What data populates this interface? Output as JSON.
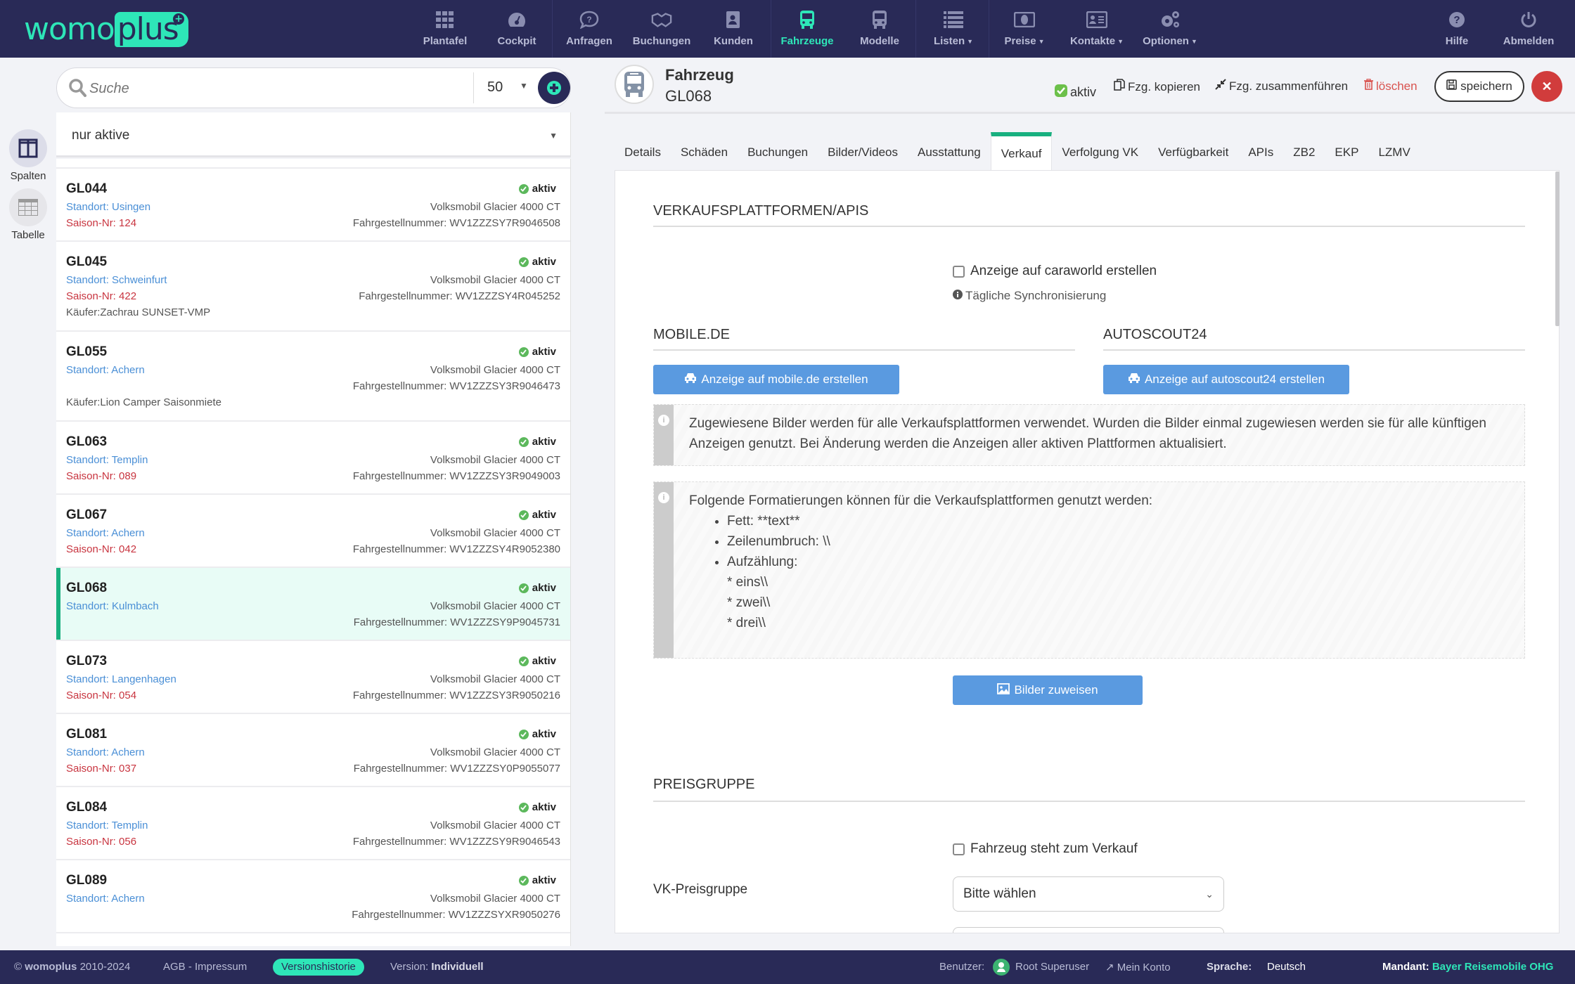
{
  "nav": {
    "brand_a": "womo",
    "brand_b": "plus",
    "items": [
      {
        "label": "Plantafel",
        "icon": "grid-icon"
      },
      {
        "label": "Cockpit",
        "icon": "dashboard-icon"
      },
      {
        "label": "Anfragen",
        "icon": "question-bubble-icon"
      },
      {
        "label": "Buchungen",
        "icon": "handshake-icon"
      },
      {
        "label": "Kunden",
        "icon": "address-book-icon"
      },
      {
        "label": "Fahrzeuge",
        "icon": "bus-icon",
        "active": true
      },
      {
        "label": "Modelle",
        "icon": "bus-icon"
      },
      {
        "label": "Listen",
        "icon": "list-icon",
        "dropdown": true
      },
      {
        "label": "Preise",
        "icon": "money-icon",
        "dropdown": true
      },
      {
        "label": "Kontakte",
        "icon": "contact-card-icon",
        "dropdown": true
      },
      {
        "label": "Optionen",
        "icon": "gears-icon",
        "dropdown": true
      }
    ],
    "help": "Hilfe",
    "logout": "Abmelden"
  },
  "rail": {
    "columns_label": "Spalten",
    "table_label": "Tabelle"
  },
  "search": {
    "placeholder": "Suche",
    "page_size": "50"
  },
  "filter": {
    "selected": "nur aktive"
  },
  "vehicles": [
    {
      "code": "GL044",
      "status": "aktiv",
      "location": "Standort: Usingen",
      "season": "Saison-Nr: 124",
      "buyer": "",
      "model": "Volksmobil Glacier 4000 CT",
      "vin": "Fahrgestellnummer: WV1ZZZSY7R9046508"
    },
    {
      "code": "GL045",
      "status": "aktiv",
      "location": "Standort: Schweinfurt",
      "season": "Saison-Nr: 422",
      "buyer": "Käufer:Zachrau SUNSET-VMP",
      "model": "Volksmobil Glacier 4000 CT",
      "vin": "Fahrgestellnummer: WV1ZZZSY4R045252"
    },
    {
      "code": "GL055",
      "status": "aktiv",
      "location": "Standort: Achern",
      "season": "",
      "buyer": "Käufer:Lion Camper Saisonmiete",
      "model": "Volksmobil Glacier 4000 CT",
      "vin": "Fahrgestellnummer: WV1ZZZSY3R9046473"
    },
    {
      "code": "GL063",
      "status": "aktiv",
      "location": "Standort: Templin",
      "season": "Saison-Nr: 089",
      "buyer": "",
      "model": "Volksmobil Glacier 4000 CT",
      "vin": "Fahrgestellnummer: WV1ZZZSY3R9049003"
    },
    {
      "code": "GL067",
      "status": "aktiv",
      "location": "Standort: Achern",
      "season": "Saison-Nr: 042",
      "buyer": "",
      "model": "Volksmobil Glacier 4000 CT",
      "vin": "Fahrgestellnummer: WV1ZZZSY4R9052380"
    },
    {
      "code": "GL068",
      "status": "aktiv",
      "location": "Standort: Kulmbach",
      "season": "",
      "buyer": "",
      "model": "Volksmobil Glacier 4000 CT",
      "vin": "Fahrgestellnummer: WV1ZZZSY9P9045731",
      "selected": true
    },
    {
      "code": "GL073",
      "status": "aktiv",
      "location": "Standort: Langenhagen",
      "season": "Saison-Nr: 054",
      "buyer": "",
      "model": "Volksmobil Glacier 4000 CT",
      "vin": "Fahrgestellnummer: WV1ZZZSY3R9050216"
    },
    {
      "code": "GL081",
      "status": "aktiv",
      "location": "Standort: Achern",
      "season": "Saison-Nr: 037",
      "buyer": "",
      "model": "Volksmobil Glacier 4000 CT",
      "vin": "Fahrgestellnummer: WV1ZZZSY0P9055077"
    },
    {
      "code": "GL084",
      "status": "aktiv",
      "location": "Standort: Templin",
      "season": "Saison-Nr: 056",
      "buyer": "",
      "model": "Volksmobil Glacier 4000 CT",
      "vin": "Fahrgestellnummer: WV1ZZZSY9R9046543"
    },
    {
      "code": "GL089",
      "status": "aktiv",
      "location": "Standort: Achern",
      "season": "",
      "buyer": "",
      "model": "Volksmobil Glacier 4000 CT",
      "vin": "Fahrgestellnummer: WV1ZZZSYXR9050276"
    }
  ],
  "detail": {
    "title": "Fahrzeug",
    "code": "GL068",
    "status": "aktiv",
    "copy": "Fzg. kopieren",
    "merge": "Fzg. zusammenführen",
    "delete": "löschen",
    "save": "speichern",
    "tabs": [
      "Details",
      "Schäden",
      "Buchungen",
      "Bilder/Videos",
      "Ausstattung",
      "Verkauf",
      "Verfolgung VK",
      "Verfügbarkeit",
      "APIs",
      "ZB2",
      "EKP",
      "LZMV"
    ],
    "active_tab": "Verkauf"
  },
  "verkauf": {
    "section_platforms": "VERKAUFSPLATTFORMEN/APIS",
    "caraworld_label": "Anzeige auf caraworld erstellen",
    "caraworld_checked": false,
    "sync_note": "Tägliche Synchronisierung",
    "mobile_heading": "MOBILE.DE",
    "mobile_button": "Anzeige auf mobile.de erstellen",
    "autoscout_heading": "AUTOSCOUT24",
    "autoscout_button": "Anzeige auf autoscout24 erstellen",
    "info1": "Zugewiesene Bilder werden für alle Verkaufsplattformen verwendet. Wurden die Bilder einmal zugewiesen werden sie für alle künftigen Anzeigen genutzt. Bei Änderung werden die Anzeigen aller aktiven Plattformen aktualisiert.",
    "info2_intro": "Folgende Formatierungen können für die Verkaufsplattformen genutzt werden:",
    "info2_bullets": [
      "Fett: **text**",
      "Zeilenumbruch: \\\\",
      "Aufzählung:"
    ],
    "info2_sub": [
      "* eins\\\\",
      "* zwei\\\\",
      "* drei\\\\"
    ],
    "assign_images": "Bilder zuweisen",
    "section_price": "PREISGRUPPE",
    "for_sale_label": "Fahrzeug steht zum Verkauf",
    "for_sale_checked": false,
    "vk_label": "VK-Preisgruppe",
    "vk_select": "Bitte wählen"
  },
  "footer": {
    "copyright_brand": "womoplus",
    "copyright_years": "2010-2024",
    "agb": "AGB - Impressum",
    "history": "Versionshistorie",
    "version_label": "Version:",
    "version_value": "Individuell",
    "user_label": "Benutzer:",
    "user_name": "Root Superuser",
    "account": "Mein Konto",
    "lang_label": "Sprache:",
    "lang_value": "Deutsch",
    "tenant_label": "Mandant:",
    "tenant_value": "Bayer Reisemobile OHG"
  },
  "colors": {
    "nav_bg": "#292a57",
    "accent": "#2ee6b8",
    "active_tab": "#18b07f",
    "primary_button": "#5a9ae0",
    "danger": "#d13c3c",
    "location_text": "#4a8fd6",
    "season_text": "#c8343f"
  }
}
